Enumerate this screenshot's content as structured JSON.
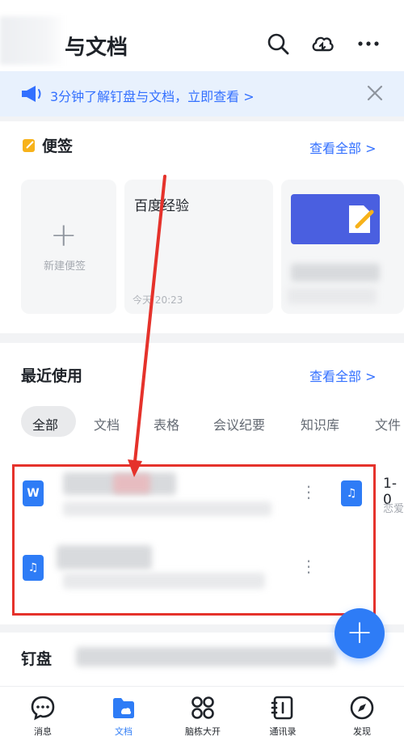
{
  "header": {
    "title": "与文档",
    "icons": [
      "search-icon",
      "cloud-upload-icon",
      "more-icon"
    ]
  },
  "banner": {
    "text": "3分钟了解钉盘与文档，立即查看 >",
    "icon": "megaphone-icon",
    "close_icon": "close-icon"
  },
  "notes": {
    "title": "便签",
    "see_all": "查看全部 >",
    "new_note_plus": "+",
    "new_note_label": "新建便签",
    "items": [
      {
        "title": "百度经验",
        "time": "今天 20:23"
      },
      {
        "title": "",
        "time": ""
      }
    ]
  },
  "recent": {
    "title": "最近使用",
    "see_all": "查看全部 >",
    "filters": [
      "全部",
      "文档",
      "表格",
      "会议纪要",
      "知识库",
      "文件"
    ],
    "active_filter": "全部",
    "items": [
      {
        "icon": "word-doc-icon",
        "icon_label": "W"
      },
      {
        "icon": "audio-file-icon",
        "icon_label": "♫"
      }
    ],
    "side_item": {
      "icon": "audio-file-icon",
      "title": "1-0",
      "sub": "恋爱"
    }
  },
  "dingpan": {
    "title": "钉盘"
  },
  "fab": {
    "label": "+"
  },
  "tabbar": {
    "items": [
      {
        "label": "消息",
        "icon": "chat-bubble-icon"
      },
      {
        "label": "文档",
        "icon": "docs-folder-icon"
      },
      {
        "label": "脑栋大开",
        "icon": "apps-grid-icon"
      },
      {
        "label": "通讯录",
        "icon": "contacts-book-icon"
      },
      {
        "label": "发现",
        "icon": "compass-icon"
      }
    ],
    "active": "文档"
  },
  "colors": {
    "accent": "#2e7cf6",
    "link": "#3370ff",
    "annotation": "#e5322b"
  }
}
